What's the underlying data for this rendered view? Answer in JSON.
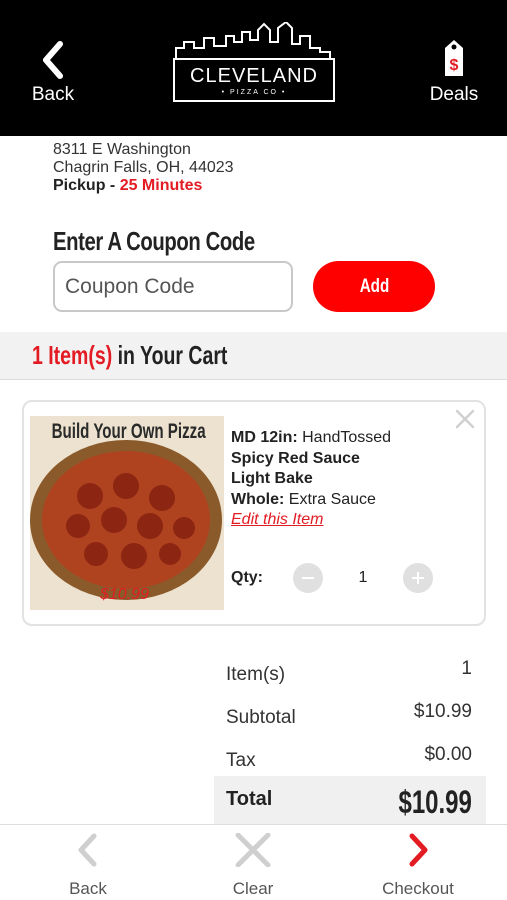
{
  "header": {
    "back_label": "Back",
    "logo_word": "CLEVELAND",
    "logo_sub": "• PIZZA CO •",
    "deals_label": "Deals"
  },
  "store": {
    "address_line1": "8311 E Washington",
    "address_line2": "Chagrin Falls, OH, 44023",
    "pickup_label": "Pickup -",
    "pickup_time": "25 Minutes"
  },
  "coupon": {
    "title": "Enter A Coupon Code",
    "placeholder": "Coupon Code",
    "add_label": "Add"
  },
  "cart": {
    "count_text": "1 Item(s)",
    "suffix_text": "in Your Cart"
  },
  "item": {
    "image_title": "Build Your Own Pizza",
    "image_price": "$10.99",
    "size_label": "MD 12in:",
    "crust": "HandTossed",
    "sauce": "Spicy Red Sauce",
    "bake": "Light Bake",
    "whole_label": "Whole:",
    "whole_value": "Extra Sauce",
    "edit_label": "Edit this Item",
    "qty_label": "Qty:",
    "qty_value": "1"
  },
  "summary": {
    "items_label": "Item(s)",
    "items_value": "1",
    "subtotal_label": "Subtotal",
    "subtotal_value": "$10.99",
    "tax_label": "Tax",
    "tax_value": "$0.00",
    "total_label": "Total",
    "total_value": "$10.99"
  },
  "bottom_nav": {
    "back_label": "Back",
    "clear_label": "Clear",
    "checkout_label": "Checkout"
  },
  "colors": {
    "accent": "#e31b23",
    "header_bg": "#000000",
    "button_red": "#ff0000"
  }
}
